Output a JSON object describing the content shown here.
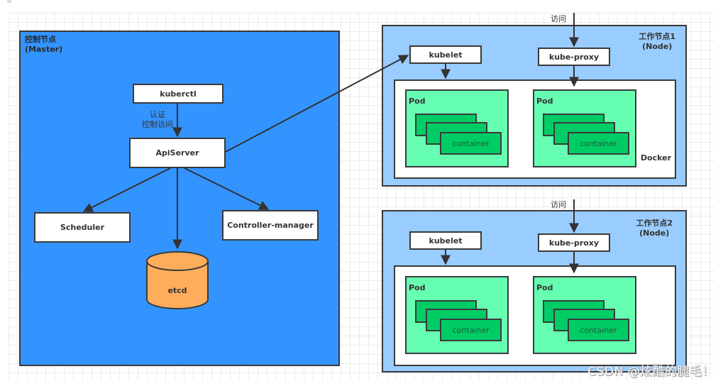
{
  "master": {
    "title_line1": "控制节点",
    "title_line2": "(Master)",
    "color": "#3394ff",
    "kubectl": "kuberctl",
    "auth_label_line1": "认证",
    "auth_label_line2": "控制访问",
    "apiserver": "ApiServer",
    "scheduler": "Scheduler",
    "controller_manager": "Controller-manager",
    "etcd": "etcd",
    "etcd_color": "#ffad5c"
  },
  "nodes": [
    {
      "title_line1": "工作节点1",
      "title_line2": "(Node)",
      "access_label": "访问",
      "kubelet": "kubelet",
      "kube_proxy": "kube-proxy",
      "runtime_label": "Docker",
      "pods": [
        {
          "label": "Pod",
          "container_label": "container"
        },
        {
          "label": "Pod",
          "container_label": "container"
        }
      ]
    },
    {
      "title_line1": "工作节点2",
      "title_line2": "(Node)",
      "access_label": "访问",
      "kubelet": "kubelet",
      "kube_proxy": "kube-proxy",
      "runtime_label": "",
      "pods": [
        {
          "label": "Pod",
          "container_label": "container"
        },
        {
          "label": "Pod",
          "container_label": "container"
        }
      ]
    }
  ],
  "colors": {
    "node_bg": "#99ccff",
    "pod_bg": "#66ffb2",
    "container_bg": "#00cc66",
    "stroke": "#3a3a3a"
  },
  "watermark": "CSDN @炫酷的腿毛！"
}
